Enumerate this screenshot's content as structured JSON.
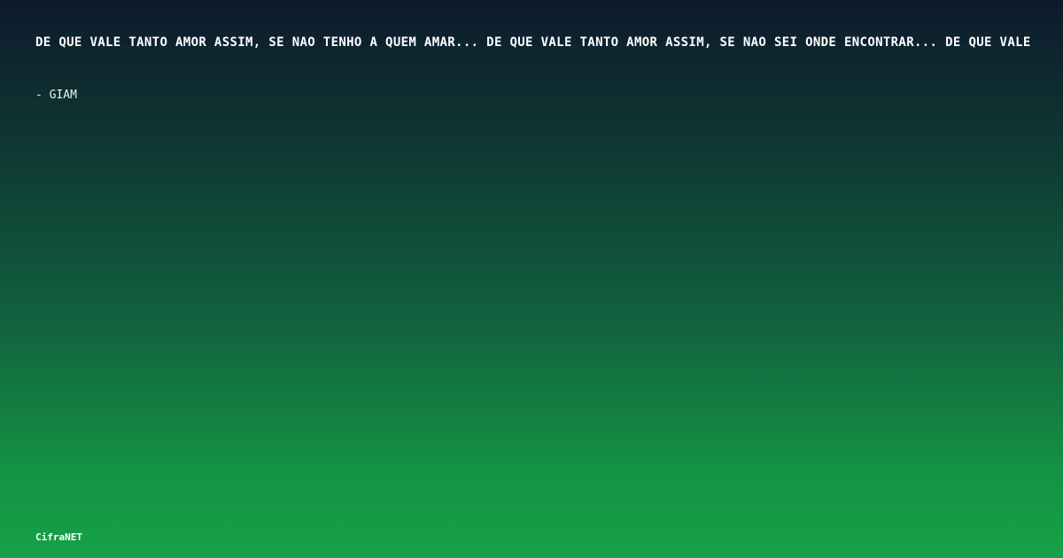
{
  "quote": {
    "text": "DE QUE VALE TANTO AMOR ASSIM, SE NAO TENHO A QUEM AMAR... DE QUE VALE TANTO AMOR ASSIM, SE NAO SEI ONDE ENCONTRAR... DE QUE VALE"
  },
  "author": {
    "text": "- GIAM"
  },
  "brand": {
    "text": "CifraNET"
  }
}
